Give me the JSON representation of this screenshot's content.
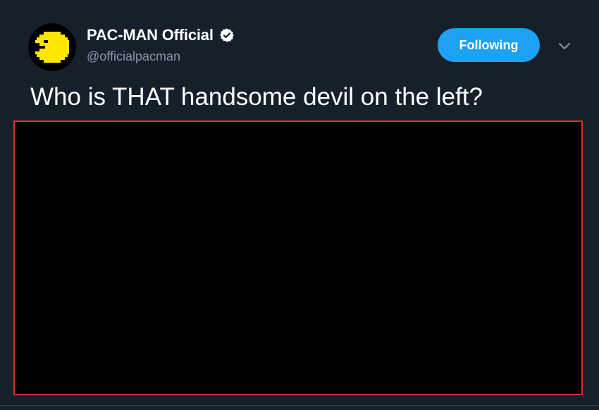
{
  "tweet": {
    "author": {
      "display_name": "PAC-MAN Official",
      "handle": "@officialpacman",
      "verified": true,
      "avatar_icon": "pacman-icon",
      "avatar_color": "#ffe600"
    },
    "follow_button": {
      "label": "Following",
      "color": "#1da1f2"
    },
    "menu_icon": "chevron-down-icon",
    "text": "Who is THAT handsome devil on the left?",
    "media": {
      "background": "#000000",
      "border_color": "#d9302c"
    }
  },
  "theme": {
    "background": "#15202b",
    "secondary_text": "#8899a6"
  }
}
